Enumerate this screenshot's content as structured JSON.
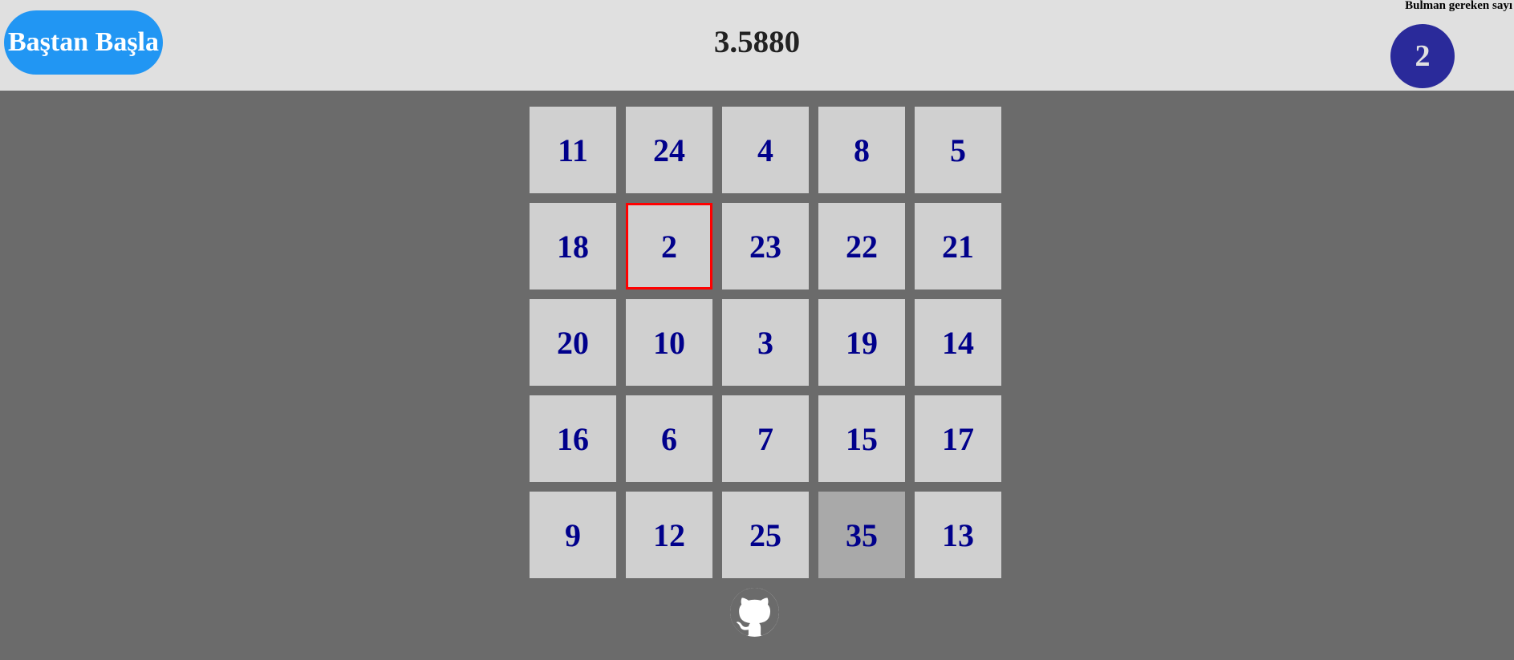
{
  "header": {
    "restart_label": "Baştan Başla",
    "timer": "3.5880",
    "target_label": "Bulman gereken sayı",
    "target_value": "2"
  },
  "grid": {
    "cells": [
      {
        "value": "11",
        "state": "normal"
      },
      {
        "value": "24",
        "state": "normal"
      },
      {
        "value": "4",
        "state": "normal"
      },
      {
        "value": "8",
        "state": "normal"
      },
      {
        "value": "5",
        "state": "normal"
      },
      {
        "value": "18",
        "state": "normal"
      },
      {
        "value": "2",
        "state": "selected"
      },
      {
        "value": "23",
        "state": "normal"
      },
      {
        "value": "22",
        "state": "normal"
      },
      {
        "value": "21",
        "state": "normal"
      },
      {
        "value": "20",
        "state": "normal"
      },
      {
        "value": "10",
        "state": "normal"
      },
      {
        "value": "3",
        "state": "normal"
      },
      {
        "value": "19",
        "state": "normal"
      },
      {
        "value": "14",
        "state": "normal"
      },
      {
        "value": "16",
        "state": "normal"
      },
      {
        "value": "6",
        "state": "normal"
      },
      {
        "value": "7",
        "state": "normal"
      },
      {
        "value": "15",
        "state": "normal"
      },
      {
        "value": "17",
        "state": "normal"
      },
      {
        "value": "9",
        "state": "normal"
      },
      {
        "value": "12",
        "state": "normal"
      },
      {
        "value": "25",
        "state": "normal"
      },
      {
        "value": "35",
        "state": "found"
      },
      {
        "value": "13",
        "state": "normal"
      }
    ]
  },
  "footer": {
    "github_icon": "github-icon"
  },
  "colors": {
    "header_bg": "#e0e0e0",
    "page_bg": "#6b6b6b",
    "button_bg": "#2196f3",
    "target_bg": "#2a2a9a",
    "cell_bg": "#d0d0d0",
    "cell_found_bg": "#a9a9a9",
    "cell_text": "#00008b",
    "selected_border": "#ff0000"
  }
}
